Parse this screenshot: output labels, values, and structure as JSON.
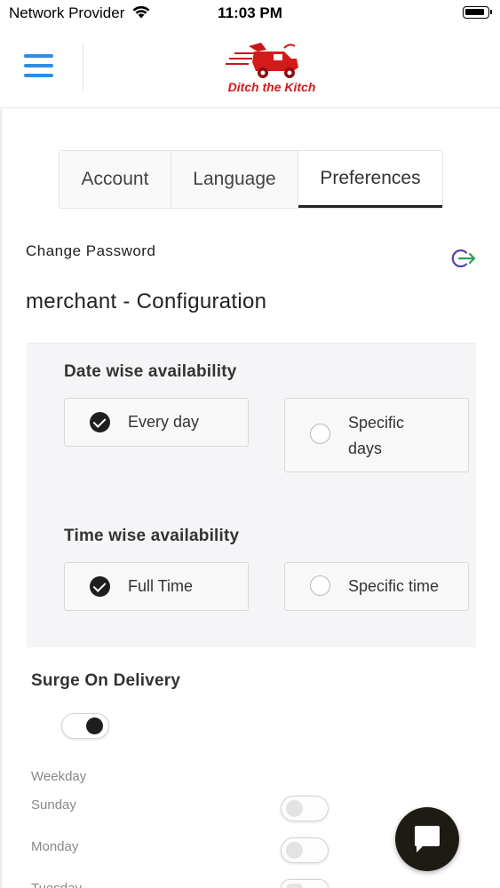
{
  "status_bar": {
    "carrier": "Network Provider",
    "time": "11:03 PM"
  },
  "header": {
    "brand": "Ditch the Kitch",
    "brand_color": "#d41a1a",
    "menu_icon_color": "#2f8de4"
  },
  "tabs": [
    {
      "label": "Account",
      "active": false
    },
    {
      "label": "Language",
      "active": false
    },
    {
      "label": "Preferences",
      "active": true
    }
  ],
  "account": {
    "change_password": "Change Password",
    "logout_icon": "logout-icon"
  },
  "config": {
    "title": "merchant - Configuration",
    "date_wise": {
      "label": "Date wise availability",
      "options": [
        {
          "label": "Every day",
          "selected": true
        },
        {
          "label": "Specific days",
          "selected": false
        }
      ]
    },
    "time_wise": {
      "label": "Time wise availability",
      "options": [
        {
          "label": "Full Time",
          "selected": true
        },
        {
          "label": "Specific time",
          "selected": false
        }
      ]
    }
  },
  "surge": {
    "label": "Surge On Delivery",
    "enabled": true,
    "weekday_header": "Weekday",
    "days": [
      {
        "label": "Sunday",
        "enabled": false
      },
      {
        "label": "Monday",
        "enabled": false
      },
      {
        "label": "Tuesday",
        "enabled": false
      }
    ]
  },
  "chat_icon": "chat-bubble-icon"
}
